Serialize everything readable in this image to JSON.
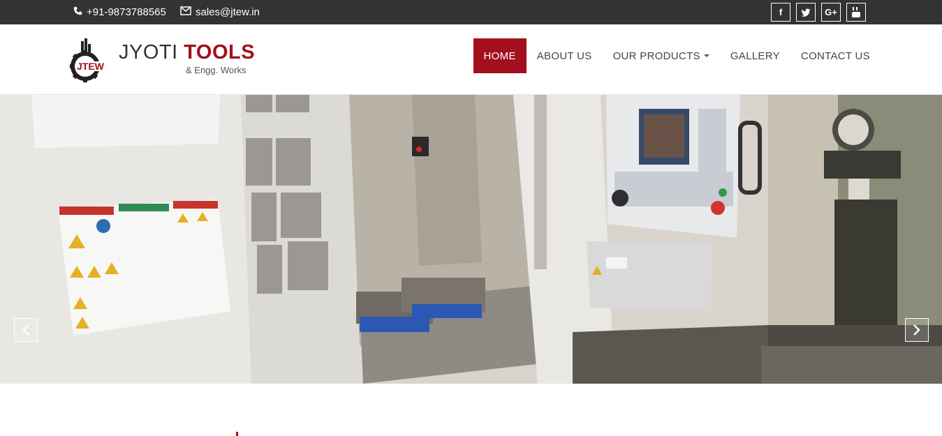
{
  "topbar": {
    "phone": "+91-9873788565",
    "email": "sales@jtew.in",
    "social": [
      {
        "icon": "facebook-icon",
        "glyph": "f"
      },
      {
        "icon": "twitter-icon",
        "glyph": "t"
      },
      {
        "icon": "google-plus-icon",
        "glyph": "G+"
      },
      {
        "icon": "youtube-icon",
        "glyph": "You"
      }
    ]
  },
  "logo": {
    "mark": "JTEW",
    "brand_1": "JYOTI",
    "brand_2": "TOOLS",
    "tagline": "& Engg. Works"
  },
  "nav": {
    "home": "HOME",
    "about": "ABOUT US",
    "products": "OUR PRODUCTS",
    "gallery": "GALLERY",
    "contact": "CONTACT US"
  },
  "colors": {
    "accent": "#a30f1e",
    "topbar": "#333333"
  }
}
